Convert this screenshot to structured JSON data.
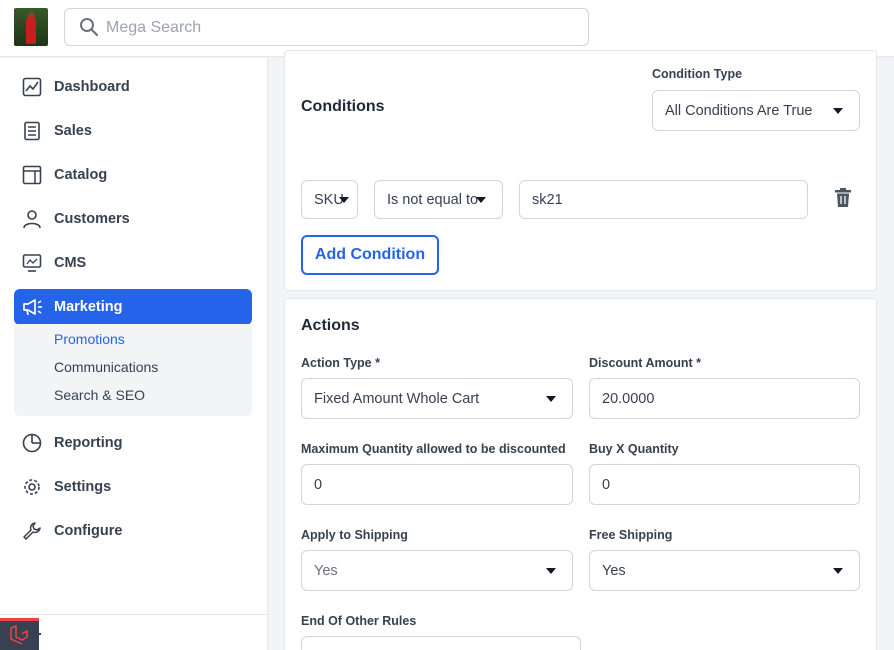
{
  "header": {
    "search_placeholder": "Mega Search"
  },
  "sidebar": {
    "items": [
      {
        "label": "Dashboard",
        "icon": "dashboard-icon"
      },
      {
        "label": "Sales",
        "icon": "sales-icon"
      },
      {
        "label": "Catalog",
        "icon": "catalog-icon"
      },
      {
        "label": "Customers",
        "icon": "customers-icon"
      },
      {
        "label": "CMS",
        "icon": "cms-icon"
      },
      {
        "label": "Marketing",
        "icon": "marketing-icon"
      },
      {
        "label": "Reporting",
        "icon": "reporting-icon"
      },
      {
        "label": "Settings",
        "icon": "settings-icon"
      },
      {
        "label": "Configure",
        "icon": "configure-icon"
      }
    ],
    "marketing_sub": [
      "Promotions",
      "Communications",
      "Search & SEO"
    ]
  },
  "conditions": {
    "title": "Conditions",
    "condition_type_label": "Condition Type",
    "condition_type_value": "All Conditions Are True",
    "attribute_value": "SKU",
    "operator_value": "Is not equal to",
    "value": "sk21",
    "add_button": "Add Condition"
  },
  "actions": {
    "title": "Actions",
    "action_type_label": "Action Type *",
    "action_type_value": "Fixed Amount Whole Cart",
    "discount_amount_label": "Discount Amount *",
    "discount_amount_value": "20.0000",
    "max_qty_label": "Maximum Quantity allowed to be discounted",
    "max_qty_value": "0",
    "buy_x_label": "Buy X Quantity",
    "buy_x_value": "0",
    "apply_shipping_label": "Apply to Shipping",
    "apply_shipping_value": "Yes",
    "free_shipping_label": "Free Shipping",
    "free_shipping_value": "Yes",
    "end_rules_label": "End Of Other Rules"
  },
  "colors": {
    "accent": "#2563eb",
    "laravel_red": "#ef4444"
  }
}
